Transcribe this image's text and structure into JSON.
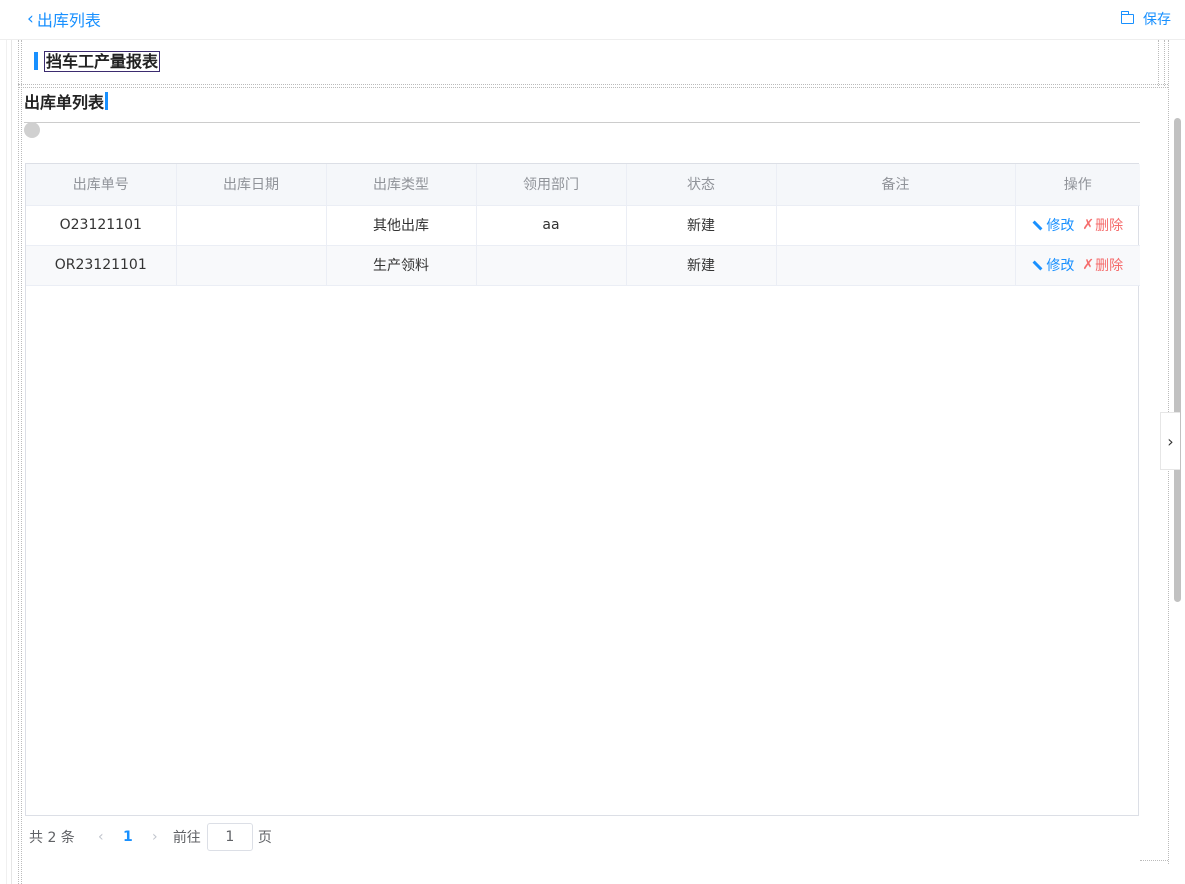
{
  "topbar": {
    "back_label": "出库列表",
    "save_label": "保存"
  },
  "document": {
    "title": "挡车工产量报表"
  },
  "section": {
    "title": "出库单列表"
  },
  "table": {
    "headers": [
      "出库单号",
      "出库日期",
      "出库类型",
      "领用部门",
      "状态",
      "备注",
      "操作"
    ],
    "rows": [
      {
        "no": "O23121101",
        "date": "",
        "type": "其他出库",
        "dept": "aa",
        "status": "新建",
        "remark": ""
      },
      {
        "no": "OR23121101",
        "date": "",
        "type": "生产领料",
        "dept": "",
        "status": "新建",
        "remark": ""
      }
    ],
    "edit_label": "修改",
    "delete_label": "删除"
  },
  "pagination": {
    "total_text": "共 2 条",
    "current_page": "1",
    "goto_label": "前往",
    "goto_value": "1",
    "page_suffix": "页"
  },
  "colors": {
    "accent": "#1890ff",
    "danger": "#f56c6c",
    "header_bg": "#f5f7fa"
  }
}
